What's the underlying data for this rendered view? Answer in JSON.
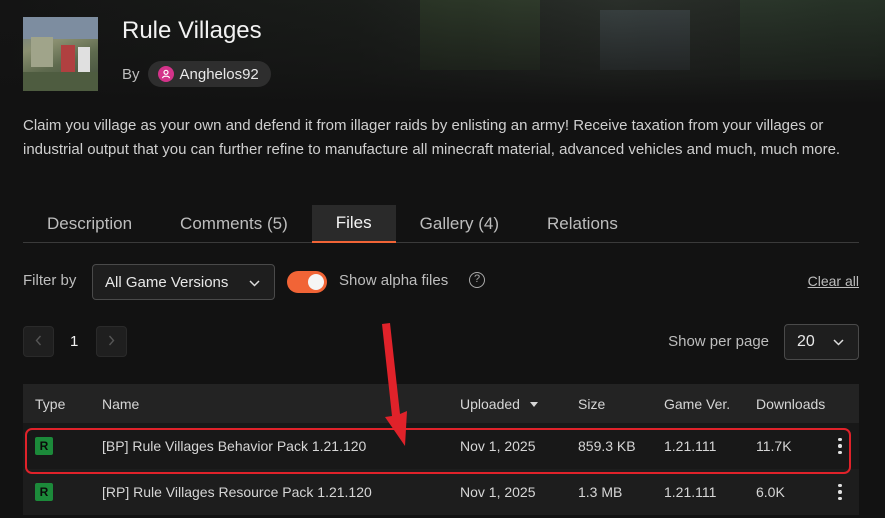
{
  "project": {
    "title": "Rule Villages",
    "by_label": "By",
    "author": "Anghelos92",
    "summary": "Claim you village as your own and defend it from illager raids by enlisting an army! Receive taxation from your villages or industrial output that you can further refine to manufacture all minecraft material, advanced vehicles and much, much more."
  },
  "tabs": [
    {
      "label": "Description",
      "active": false
    },
    {
      "label": "Comments (5)",
      "active": false
    },
    {
      "label": "Files",
      "active": true
    },
    {
      "label": "Gallery (4)",
      "active": false
    },
    {
      "label": "Relations",
      "active": false
    }
  ],
  "filters": {
    "filter_label": "Filter by",
    "version_selected": "All Game Versions",
    "alpha_label": "Show alpha files",
    "alpha_enabled": true,
    "clear_all": "Clear all"
  },
  "pager": {
    "current_page": "1",
    "per_page_label": "Show per page",
    "per_page_value": "20"
  },
  "table": {
    "headers": {
      "type": "Type",
      "name": "Name",
      "uploaded": "Uploaded",
      "size": "Size",
      "game_ver": "Game Ver.",
      "downloads": "Downloads"
    },
    "rows": [
      {
        "type": "R",
        "name": "[BP] Rule Villages Behavior Pack 1.21.120",
        "uploaded": "Nov 1, 2025",
        "size": "859.3 KB",
        "game_ver": "1.21.111",
        "downloads": "11.7K"
      },
      {
        "type": "R",
        "name": "[RP] Rule Villages Resource Pack 1.21.120",
        "uploaded": "Nov 1, 2025",
        "size": "1.3 MB",
        "game_ver": "1.21.111",
        "downloads": "6.0K"
      }
    ]
  },
  "colors": {
    "accent": "#f16436",
    "release_badge": "#1c8a3a",
    "highlight": "#e0222a",
    "author_icon": "#d4338a"
  },
  "icons": {
    "author": "user-icon",
    "select_caret": "chevron-down-icon",
    "help": "question-circle-icon",
    "prev": "chevron-left-icon",
    "next": "chevron-right-icon",
    "sort": "sort-down-icon",
    "more": "kebab-menu-icon"
  }
}
